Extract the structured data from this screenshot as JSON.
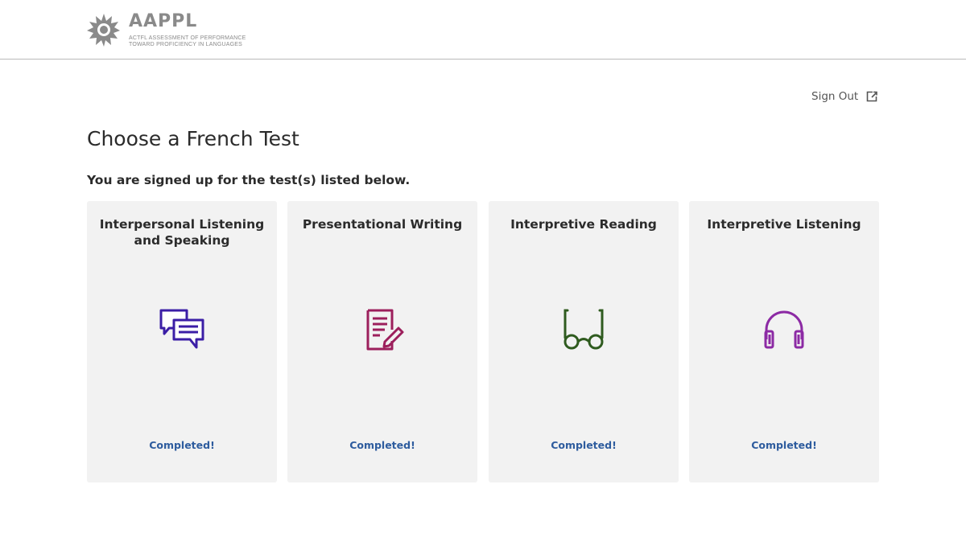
{
  "header": {
    "logo": {
      "wordmark": "AAPPL",
      "tagline_line1": "ACTFL ASSESSMENT OF PERFORMANCE",
      "tagline_line2": "TOWARD PROFICIENCY IN LANGUAGES",
      "icon": "starburst-logo-icon",
      "color": "#8a8a8a"
    }
  },
  "signout": {
    "label": "Sign Out",
    "icon": "external-link-icon"
  },
  "page": {
    "title": "Choose a French Test",
    "subtitle": "You are signed up for the test(s) listed below."
  },
  "tests": [
    {
      "title": "Interpersonal Listening and Speaking",
      "icon": "chat-bubbles-icon",
      "icon_color": "#3b1ea6",
      "status": "Completed!"
    },
    {
      "title": "Presentational Writing",
      "icon": "document-edit-icon",
      "icon_color": "#9c1f5c",
      "status": "Completed!"
    },
    {
      "title": "Interpretive Reading",
      "icon": "glasses-icon",
      "icon_color": "#2f5b1f",
      "status": "Completed!"
    },
    {
      "title": "Interpretive Listening",
      "icon": "headphones-icon",
      "icon_color": "#8c2aa4",
      "status": "Completed!"
    }
  ],
  "colors": {
    "status_text": "#2e5c9e",
    "card_background": "#f2f2f2"
  }
}
